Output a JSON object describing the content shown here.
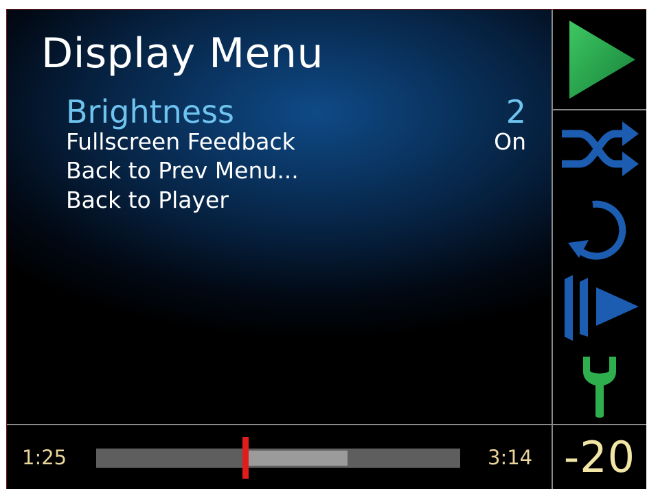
{
  "menu": {
    "title": "Display Menu",
    "items": [
      {
        "label": "Brightness",
        "value": "2"
      },
      {
        "label": "Fullscreen Feedback",
        "value": "On"
      },
      {
        "label": "Back to Prev Menu...",
        "value": ""
      },
      {
        "label": "Back to Player",
        "value": ""
      }
    ],
    "selected": "Brightness"
  },
  "sidebar": {
    "buttons": [
      {
        "name": "play",
        "icon": "play-icon",
        "color": "#2fae4e"
      },
      {
        "name": "shuffle",
        "icon": "shuffle-icon",
        "color": "#1c5db2"
      },
      {
        "name": "repeat",
        "icon": "repeat-icon",
        "color": "#1c5db2"
      },
      {
        "name": "skip",
        "icon": "skip-forward-icon",
        "color": "#1c5db2"
      },
      {
        "name": "settings",
        "icon": "wrench-icon",
        "color": "#2fae4e"
      }
    ]
  },
  "player": {
    "elapsed": "1:25",
    "total": "3:14",
    "position_fraction": 0.41,
    "buffered_fraction": 0.69,
    "volume": "-20"
  },
  "colors": {
    "accent_selected": "#6fc3ef",
    "time_text": "#ead59a",
    "volume_text": "#f2e6a6",
    "progress_handle": "#e01c1c"
  }
}
